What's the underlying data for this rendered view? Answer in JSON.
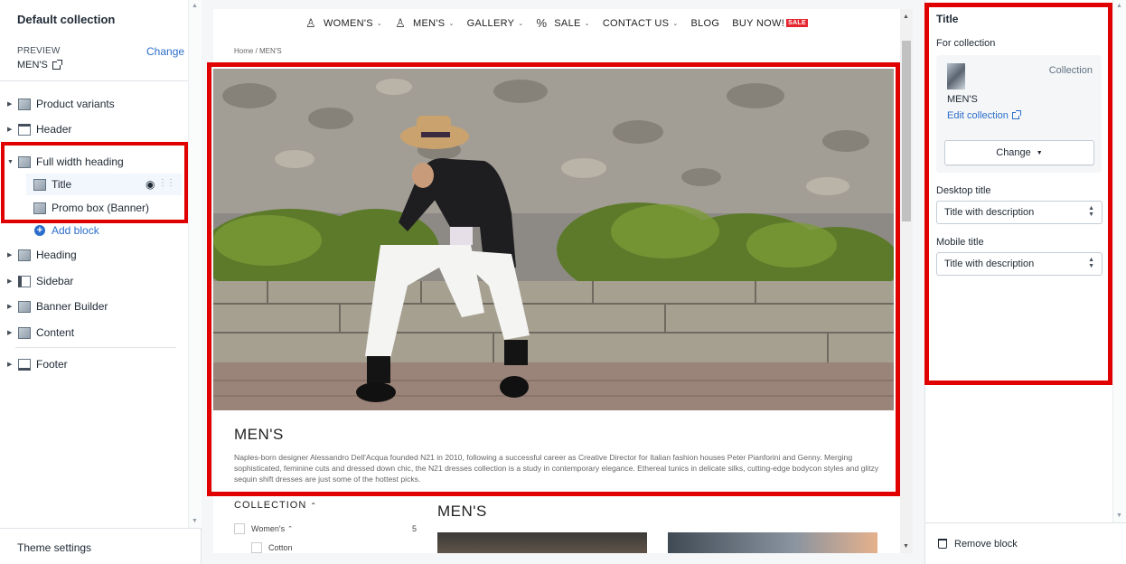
{
  "left": {
    "title": "Default collection",
    "preview_label": "PREVIEW",
    "change_label": "Change",
    "preview_value": "MEN'S",
    "tree": [
      {
        "label": "Product variants",
        "icon": "image-icon"
      },
      {
        "label": "Header",
        "icon": "header-icon"
      },
      {
        "label": "Full width heading",
        "icon": "image-icon"
      },
      {
        "label": "Heading",
        "icon": "image-icon"
      },
      {
        "label": "Sidebar",
        "icon": "sidebar-icon"
      },
      {
        "label": "Banner Builder",
        "icon": "image-icon"
      },
      {
        "label": "Content",
        "icon": "content-icon"
      },
      {
        "label": "Footer",
        "icon": "footer-icon"
      }
    ],
    "subitems": [
      {
        "label": "Title"
      },
      {
        "label": "Promo box (Banner)"
      }
    ],
    "add_block": "Add block",
    "theme_settings": "Theme settings"
  },
  "preview": {
    "nav": [
      "WOMEN'S",
      "MEN'S",
      "GALLERY",
      "SALE",
      "CONTACT US",
      "BLOG",
      "BUY NOW!"
    ],
    "sale_tag": "SALE",
    "breadcrumb": "Home  /  MEN'S",
    "heading": "MEN'S",
    "description": "Naples-born designer Alessandro Dell'Acqua founded N21 in 2010, following a successful career as Creative Director for Italian fashion houses Peter Pianforini and Genny. Merging sophisticated, feminine cuts and dressed down chic, the N21 dresses collection is a study in contemporary elegance. Ethereal tunics in delicate silks, cutting-edge bodycon styles and glitzy sequin shift dresses are just some of the hottest picks.",
    "collection_label": "COLLECTION",
    "filter_womens": "Women's",
    "filter_womens_count": "5",
    "filter_cotton": "Cotton",
    "grid_heading": "MEN'S"
  },
  "right": {
    "title": "Title",
    "for_collection": "For collection",
    "collection_type": "Collection",
    "collection_name": "MEN'S",
    "edit_collection": "Edit collection",
    "change_button": "Change",
    "desktop_title_label": "Desktop title",
    "desktop_title_value": "Title with description",
    "mobile_title_label": "Mobile title",
    "mobile_title_value": "Title with description",
    "remove_block": "Remove block"
  },
  "colors": {
    "highlight_red": "#e00000",
    "link_blue": "#2c6ecb",
    "sale_red": "#e5262e"
  }
}
